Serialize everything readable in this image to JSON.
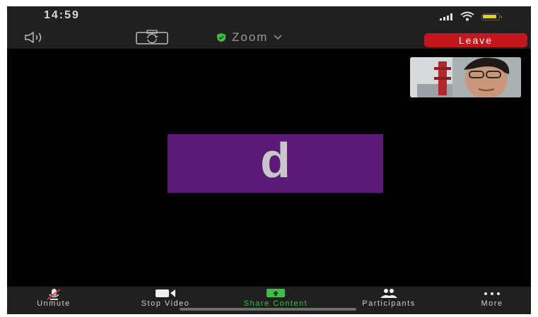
{
  "status_bar": {
    "time": "14:59",
    "icons": [
      "signal-icon",
      "wifi-icon",
      "battery-icon"
    ],
    "battery_color": "#e6d21e"
  },
  "top_bar": {
    "meeting_title": "Zoom",
    "leave_label": "Leave",
    "icons": [
      "speaker-icon",
      "switch-camera-icon",
      "shield-icon",
      "chevron-down-icon"
    ],
    "colors": {
      "leave": "#c4161d",
      "shield": "#3dbd4a"
    }
  },
  "stage": {
    "avatar_initial": "d",
    "avatar_color": "#5b1a77"
  },
  "toolbar": {
    "items": [
      {
        "label": "Unmute",
        "icon": "muted-mic-icon"
      },
      {
        "label": "Stop Video",
        "icon": "video-camera-icon"
      },
      {
        "label": "Share Content",
        "icon": "share-arrow-icon"
      },
      {
        "label": "Participants",
        "icon": "participants-icon"
      },
      {
        "label": "More",
        "icon": "more-dots-icon"
      }
    ],
    "colors": {
      "share": "#3dbd4a",
      "unmute_slash": "#d9333a"
    }
  }
}
